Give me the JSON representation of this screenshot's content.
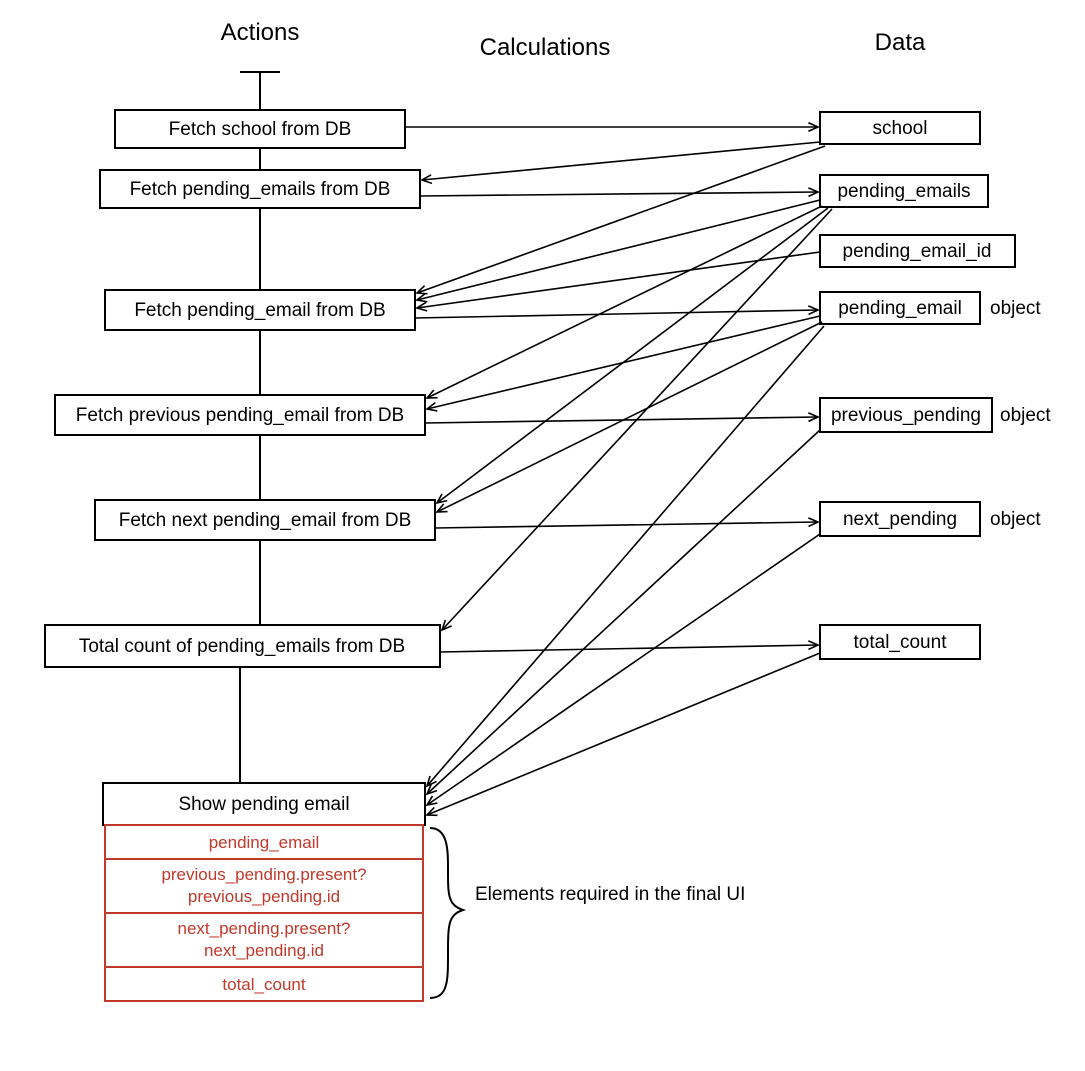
{
  "headings": {
    "actions": "Actions",
    "calculations": "Calculations",
    "data": "Data"
  },
  "actions": [
    "Fetch school from DB",
    "Fetch pending_emails from DB",
    "Fetch pending_email from DB",
    "Fetch previous pending_email from DB",
    "Fetch next pending_email from DB",
    "Total count of pending_emails from DB",
    "Show pending email"
  ],
  "data_nodes": [
    "school",
    "pending_emails",
    "pending_email_id",
    "pending_email",
    "previous_pending",
    "next_pending",
    "total_count"
  ],
  "data_annotations": {
    "pending_email": "object",
    "previous_pending": "object",
    "next_pending": "object"
  },
  "ui_elements": [
    [
      "pending_email"
    ],
    [
      "previous_pending.present?",
      "previous_pending.id"
    ],
    [
      "next_pending.present?",
      "next_pending.id"
    ],
    [
      "total_count"
    ]
  ],
  "brace_label": "Elements required in the final UI"
}
